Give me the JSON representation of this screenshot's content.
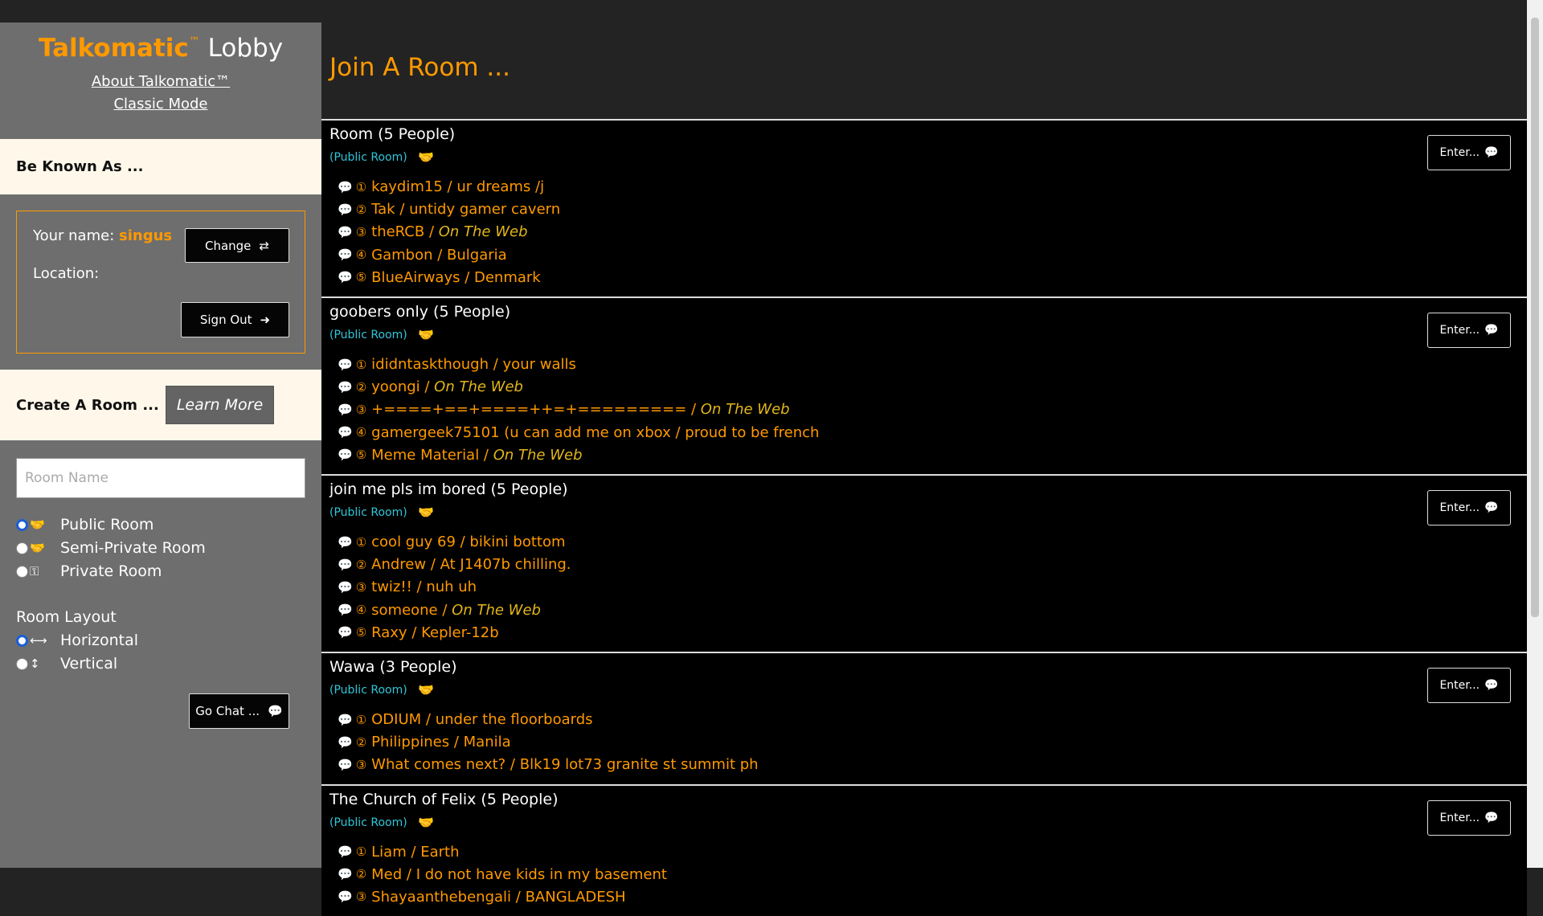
{
  "sidebar": {
    "brand": "Talkomatic",
    "tm": "™",
    "lobby": "Lobby",
    "links": [
      "About Talkomatic™",
      "Classic Mode"
    ],
    "known_as": "Be Known As ...",
    "name_label": "Your name:",
    "name_value": "singus",
    "location_label": "Location:",
    "change_label": "Change",
    "signout_label": "Sign Out",
    "create_label": "Create A Room ...",
    "learn_more": "Learn More",
    "room_name_placeholder": "Room Name",
    "room_types": [
      {
        "label": "Public Room",
        "icon": "handshake-icon",
        "selected": true
      },
      {
        "label": "Semi-Private Room",
        "icon": "handshake-slash-icon",
        "selected": false
      },
      {
        "label": "Private Room",
        "icon": "key-icon",
        "selected": false
      }
    ],
    "layout_label": "Room Layout",
    "layouts": [
      {
        "label": "Horizontal",
        "icon": "arrows-horizontal-icon",
        "selected": true
      },
      {
        "label": "Vertical",
        "icon": "arrows-vertical-icon",
        "selected": false
      }
    ],
    "go_chat": "Go Chat ..."
  },
  "main": {
    "title": "Join A Room ...",
    "enter_label": "Enter...",
    "rooms": [
      {
        "name": "Room (5 People)",
        "type": "(Public Room)",
        "members": [
          {
            "num": "①",
            "name": "kaydim15",
            "location": "ur dreams /j",
            "web": false
          },
          {
            "num": "②",
            "name": "Tak",
            "location": "untidy gamer cavern",
            "web": false
          },
          {
            "num": "③",
            "name": "theRCB",
            "location": "On The Web",
            "web": true
          },
          {
            "num": "④",
            "name": "Gambon",
            "location": "Bulgaria",
            "web": false
          },
          {
            "num": "⑤",
            "name": "BlueAirways",
            "location": "Denmark",
            "web": false
          }
        ]
      },
      {
        "name": "goobers only (5 People)",
        "type": "(Public Room)",
        "members": [
          {
            "num": "①",
            "name": "ididntaskthough",
            "location": "your walls",
            "web": false
          },
          {
            "num": "②",
            "name": "yoongi",
            "location": "On The Web",
            "web": true
          },
          {
            "num": "③",
            "name": "+====+==+====++=+=========",
            "location": "On The Web",
            "web": true
          },
          {
            "num": "④",
            "name": "gamergeek75101 (u can add me on xbox",
            "location": "proud to be french",
            "web": false
          },
          {
            "num": "⑤",
            "name": "Meme Material",
            "location": "On The Web",
            "web": true
          }
        ]
      },
      {
        "name": "join me pls im bored (5 People)",
        "type": "(Public Room)",
        "members": [
          {
            "num": "①",
            "name": "cool guy 69",
            "location": "bikini bottom",
            "web": false
          },
          {
            "num": "②",
            "name": "Andrew",
            "location": "At J1407b chilling.",
            "web": false
          },
          {
            "num": "③",
            "name": "twiz!!",
            "location": "nuh uh",
            "web": false
          },
          {
            "num": "④",
            "name": "someone",
            "location": "On The Web",
            "web": true
          },
          {
            "num": "⑤",
            "name": "Raxy",
            "location": "Kepler-12b",
            "web": false
          }
        ]
      },
      {
        "name": "Wawa (3 People)",
        "type": "(Public Room)",
        "members": [
          {
            "num": "①",
            "name": "ODIUM",
            "location": "under the floorboards",
            "web": false
          },
          {
            "num": "②",
            "name": "Philippines",
            "location": "Manila",
            "web": false
          },
          {
            "num": "③",
            "name": "What comes next?",
            "location": "Blk19 lot73 granite st summit ph",
            "web": false
          }
        ]
      },
      {
        "name": "The Church of Felix (5 People)",
        "type": "(Public Room)",
        "members": [
          {
            "num": "①",
            "name": "Liam",
            "location": "Earth",
            "web": false
          },
          {
            "num": "②",
            "name": "Med",
            "location": "I do not have kids in my basement",
            "web": false
          },
          {
            "num": "③",
            "name": "Shayaanthebengali",
            "location": "BANGLADESH",
            "web": false
          }
        ]
      }
    ]
  }
}
